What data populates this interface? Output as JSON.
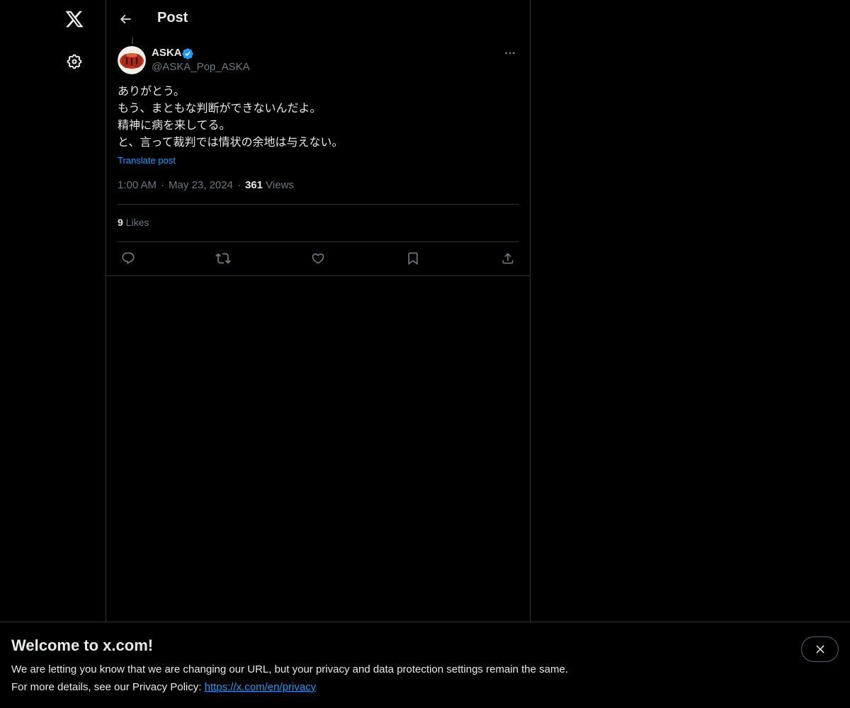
{
  "header": {
    "title": "Post"
  },
  "tweet": {
    "display_name": "ASKA",
    "handle": "@ASKA_Pop_ASKA",
    "text_lines": [
      "ありがとう。",
      "もう、まともな判断ができないんだよ。",
      "精神に病を来してる。",
      "と、言って裁判では情状の余地は与えない。"
    ],
    "translate_label": "Translate post",
    "time": "1:00 AM",
    "separator": "·",
    "date": "May 23, 2024",
    "views_count": "361",
    "views_label": "Views",
    "likes_count": "9",
    "likes_label": "Likes"
  },
  "banner": {
    "title": "Welcome to x.com!",
    "line1": "We are letting you know that we are changing our URL, but your privacy and data protection settings remain the same.",
    "line2_prefix": "For more details, see our Privacy Policy:",
    "link": "https://x.com/en/privacy"
  },
  "icons": {
    "logo": "x-logo-icon",
    "settings": "gear-icon",
    "back": "arrow-left-icon",
    "verified": "verified-badge-icon",
    "more": "more-horizontal-icon",
    "reply": "reply-icon",
    "repost": "repost-icon",
    "like": "heart-icon",
    "bookmark": "bookmark-icon",
    "share": "share-icon",
    "close": "close-icon"
  },
  "colors": {
    "background": "#000000",
    "text": "#e7e9ea",
    "secondary": "#71767b",
    "accent": "#1d9bf0",
    "border": "#2f3336"
  }
}
